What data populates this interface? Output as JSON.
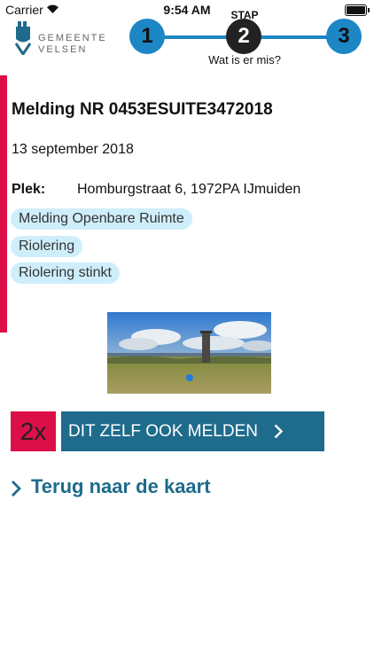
{
  "status_bar": {
    "carrier": "Carrier",
    "time": "9:54 AM"
  },
  "brand": {
    "line1": "GEMEENTE",
    "line2": "VELSEN"
  },
  "stepper": {
    "heading": "STAP",
    "steps": [
      "1",
      "2",
      "3"
    ],
    "active_step": 2,
    "caption": "Wat is er mis?"
  },
  "report": {
    "title": "Melding NR 0453ESUITE3472018",
    "date": "13 september 2018",
    "location_label": "Plek:",
    "location_value": "Homburgstraat 6, 1972PA IJmuiden",
    "tags": [
      "Melding Openbare Ruimte",
      "Riolering",
      "Riolering stinkt"
    ]
  },
  "actions": {
    "report_count": "2x",
    "report_button": "DIT ZELF OOK MELDEN",
    "back_link": "Terug naar de kaart"
  },
  "colors": {
    "accent": "#dc0f48",
    "step_blue": "#1d86c5",
    "button_blue": "#1e6b8c",
    "tag_bg": "#cfeefb"
  }
}
